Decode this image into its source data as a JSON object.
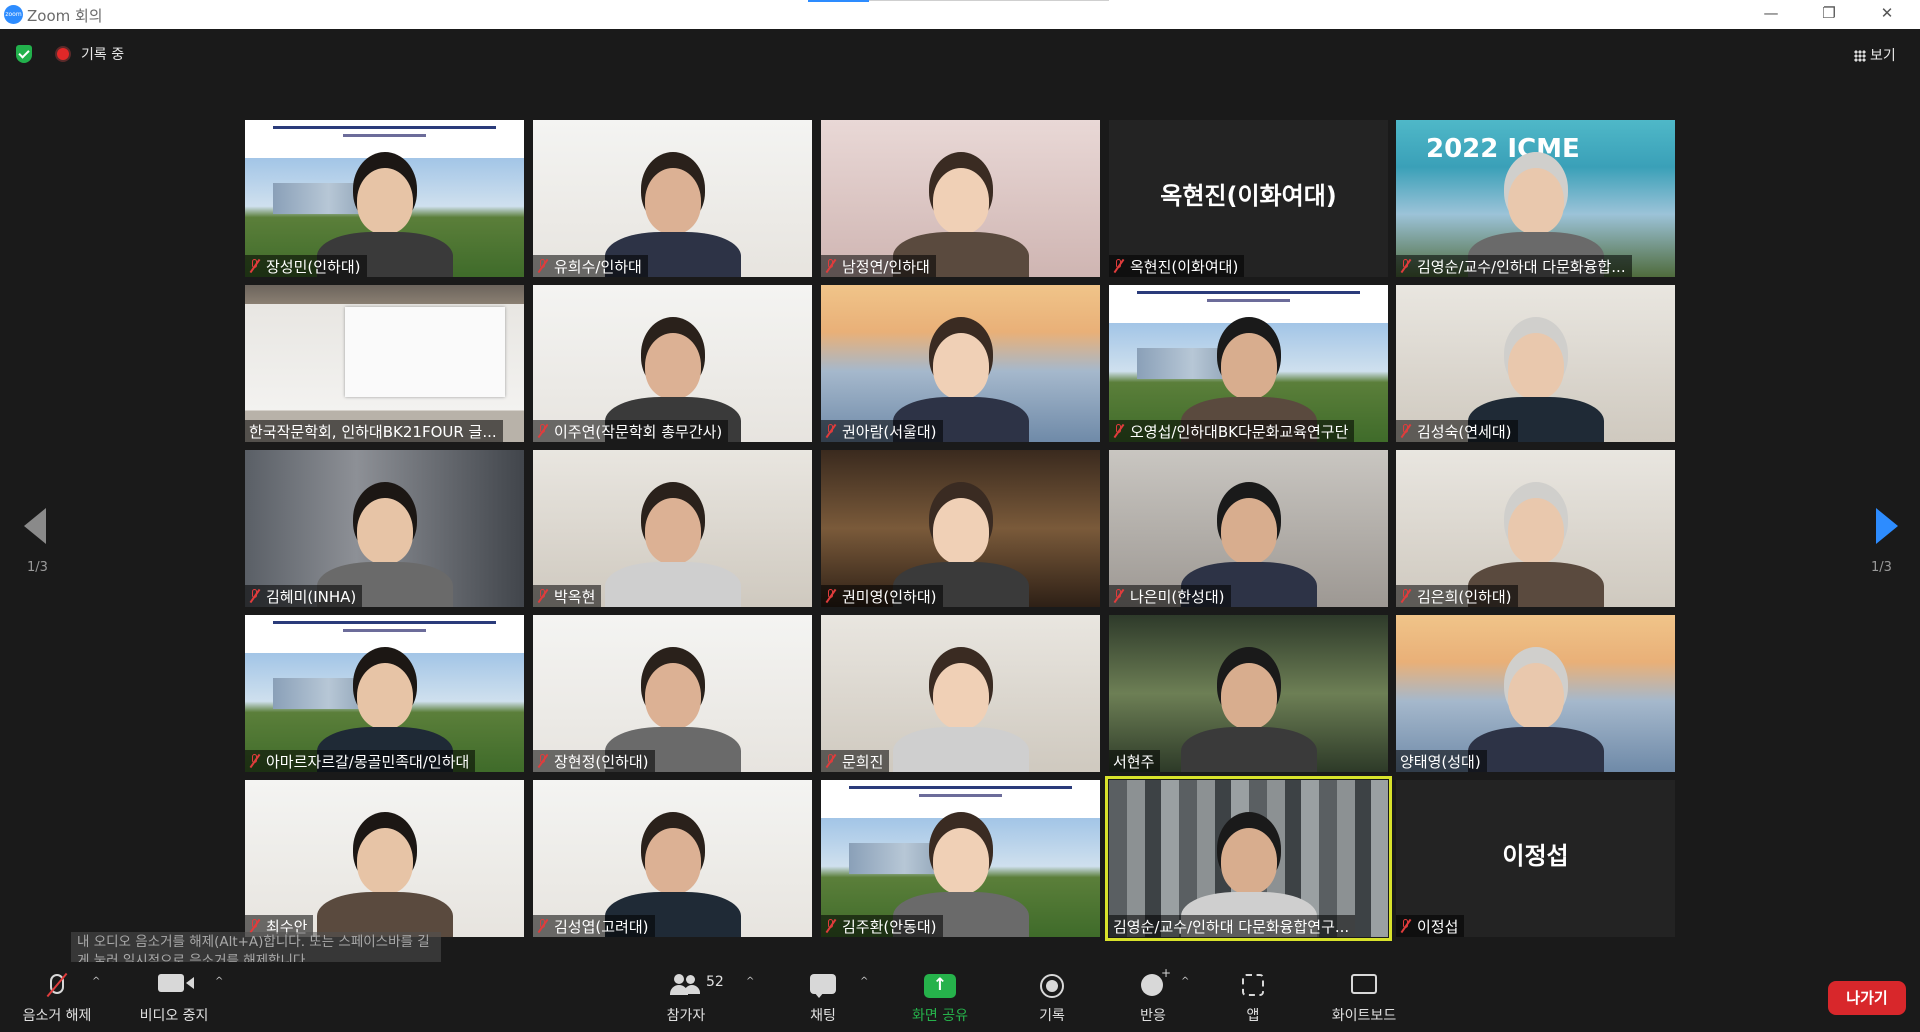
{
  "window": {
    "title": "Zoom 회의",
    "logo_text": "zoom",
    "min_glyph": "—",
    "restore_glyph": "❐",
    "close_glyph": "✕"
  },
  "status": {
    "recording_label": "기록 중",
    "view_label": "보기"
  },
  "paging": {
    "left": "1/3",
    "right": "1/3"
  },
  "participants": [
    {
      "name": "장성민(인하대)",
      "muted": true,
      "scene": "campus"
    },
    {
      "name": "유희수/인하대",
      "muted": true,
      "scene": "white"
    },
    {
      "name": "남정연/인하대",
      "muted": true,
      "scene": "pink"
    },
    {
      "name": "옥현진(이화여대)",
      "muted": true,
      "scene": "dark",
      "display_name": "옥현진(이화여대)"
    },
    {
      "name": "김영순/교수/인하대 다문화융합...",
      "muted": true,
      "scene": "blue",
      "overlay_text": "2022 ICME"
    },
    {
      "name": "한국작문학회, 인하대BK21FOUR 글...",
      "muted": false,
      "scene": "screen"
    },
    {
      "name": "이주연(작문학회 총무간사)",
      "muted": true,
      "scene": "white"
    },
    {
      "name": "권아람(서울대)",
      "muted": true,
      "scene": "bridge"
    },
    {
      "name": "오영섭/인하대BK다문화교육연구단",
      "muted": true,
      "scene": "campus"
    },
    {
      "name": "김성숙(연세대)",
      "muted": true,
      "scene": "room"
    },
    {
      "name": "김혜미(INHA)",
      "muted": true,
      "scene": "shelf"
    },
    {
      "name": "박옥현",
      "muted": true,
      "scene": "room"
    },
    {
      "name": "권미영(인하대)",
      "muted": true,
      "scene": "warm"
    },
    {
      "name": "나은미(한성대)",
      "muted": true,
      "scene": "gray"
    },
    {
      "name": "김은희(인하대)",
      "muted": true,
      "scene": "room"
    },
    {
      "name": "아마르자르갈/몽골민족대/인하대",
      "muted": true,
      "scene": "campus"
    },
    {
      "name": "장현정(인하대)",
      "muted": true,
      "scene": "white"
    },
    {
      "name": "문희진",
      "muted": true,
      "scene": "room"
    },
    {
      "name": "서현주",
      "muted": false,
      "scene": "green"
    },
    {
      "name": "양태영(성대)",
      "muted": false,
      "scene": "bridge"
    },
    {
      "name": "최수안",
      "muted": true,
      "scene": "white"
    },
    {
      "name": "김성엽(고려대)",
      "muted": true,
      "scene": "white"
    },
    {
      "name": "김주환(안동대)",
      "muted": true,
      "scene": "campus"
    },
    {
      "name": "김영순/교수/인하대 다문화융합연구...",
      "muted": false,
      "scene": "blurry",
      "active_speaker": true
    },
    {
      "name": "이정섭",
      "muted": true,
      "scene": "dark",
      "display_name": "이정섭"
    }
  ],
  "tooltip": {
    "text": "내 오디오 음소거를 해제(Alt+A)합니다. 또는 스페이스바를 길게 눌러 일시적으로 음소거를 해제합니다."
  },
  "toolbar": {
    "unmute_label": "음소거 해제",
    "stop_video_label": "비디오 중지",
    "participants_label": "참가자",
    "participants_count": "52",
    "chat_label": "채팅",
    "share_label": "화면 공유",
    "record_label": "기록",
    "reactions_label": "반응",
    "apps_label": "앱",
    "whiteboard_label": "화이트보드",
    "leave_label": "나가기",
    "caret": "^"
  },
  "colors": {
    "share_green": "#26b24b",
    "leave_red": "#d8272b",
    "active_outline": "#d8e22b",
    "accent_blue": "#2d8cff",
    "muted_red": "#e03c3c"
  }
}
